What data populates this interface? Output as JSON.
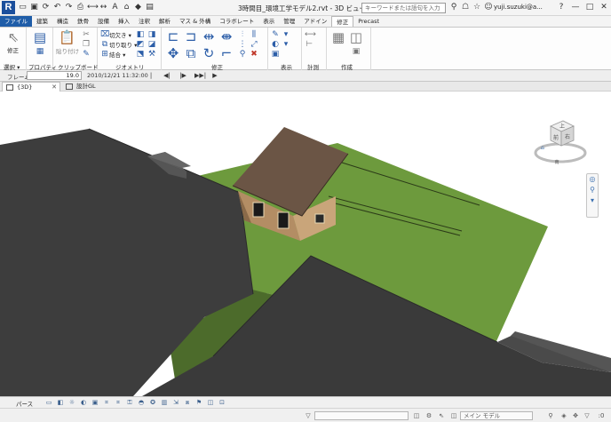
{
  "app": {
    "logo": "R",
    "title": "3時間目_環境工学モデル2.rvt - 3D ビュー: {3D}",
    "user": "yuji.suzuki@a..."
  },
  "search": {
    "placeholder": "キーワードまたは語句を入力"
  },
  "quick_access_icons": [
    "open-icon",
    "save-icon",
    "sync-icon",
    "undo-icon",
    "redo-icon",
    "print-icon",
    "measure-icon",
    "dimension-icon",
    "text-icon",
    "3d-view-icon",
    "section-icon",
    "switch-windows-icon"
  ],
  "window_controls": [
    "minimize",
    "maximize",
    "close"
  ],
  "ribbon_tabs": [
    {
      "label": "ファイル",
      "state": "file"
    },
    {
      "label": "建築",
      "state": ""
    },
    {
      "label": "構造",
      "state": ""
    },
    {
      "label": "鉄骨",
      "state": ""
    },
    {
      "label": "設備",
      "state": ""
    },
    {
      "label": "挿入",
      "state": ""
    },
    {
      "label": "注釈",
      "state": ""
    },
    {
      "label": "解析",
      "state": ""
    },
    {
      "label": "マス & 外構",
      "state": ""
    },
    {
      "label": "コラボレート",
      "state": ""
    },
    {
      "label": "表示",
      "state": ""
    },
    {
      "label": "管理",
      "state": ""
    },
    {
      "label": "アドイン",
      "state": ""
    },
    {
      "label": "修正",
      "state": "active"
    },
    {
      "label": "Precast",
      "state": ""
    }
  ],
  "ribbon": {
    "modify_label": "修正",
    "select_label": "選択 ▾",
    "properties_label": "プロパティ",
    "clipboard_label": "クリップボード",
    "paste_label": "貼り付け",
    "geometry_label": "ジオメトリ",
    "cut_label": "切欠き ▾",
    "unjoin_label": "切り取り ▾",
    "join_label": "結合 ▾",
    "modify_group_label": "修正",
    "view_label": "表示",
    "measure_label": "計測",
    "create_label": "作成"
  },
  "options_bar": {
    "frame_label": "フレーム",
    "frame_value": "19.0",
    "date": "2010/12/21 11:32:00",
    "controls": [
      "|◀◀",
      "◀|",
      "|▶",
      "▶▶|",
      "▶"
    ]
  },
  "view_tabs": [
    {
      "label": "{3D}",
      "active": true
    },
    {
      "label": "設計GL",
      "active": false
    }
  ],
  "viewcube": {
    "face_top": "上",
    "face_front": "前",
    "face_side": "右",
    "compass": "南"
  },
  "status": {
    "text": "パース",
    "scale_field": "",
    "model_field": "メイン モデル",
    "filter_value": ":0"
  },
  "colors": {
    "ground": "#6d9a3d",
    "ground_shadow": "#425e25",
    "building_dark": "#3d3d3d",
    "roof": "#6b5545",
    "wall": "#c9a57a",
    "accent_blue": "#1f5da8"
  }
}
